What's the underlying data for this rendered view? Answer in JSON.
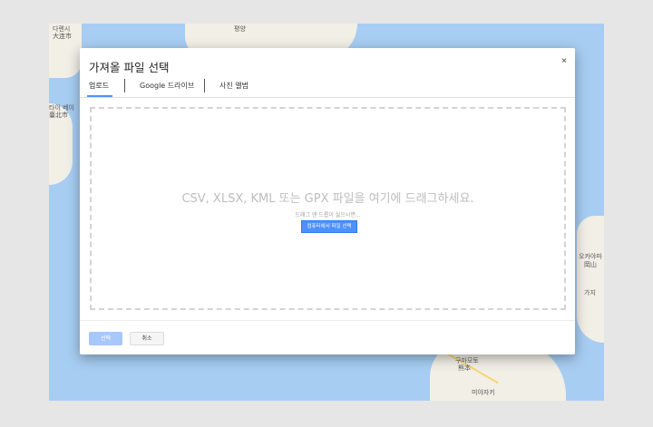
{
  "map": {
    "labels": [
      "다렌시",
      "大连市",
      "평양",
      "타이 베이",
      "臺北市",
      "오카야마",
      "岡山",
      "가지",
      "구마모토",
      "熊本",
      "미야자키"
    ]
  },
  "dialog": {
    "title": "가져올 파일 선택",
    "close_glyph": "×",
    "tabs": [
      {
        "label": "업로드"
      },
      {
        "label": "Google 드라이브"
      },
      {
        "label": "사진 앨범"
      }
    ],
    "dropzone": {
      "heading": "CSV, XLSX, KML 또는 GPX 파일을 여기에 드래그하세요.",
      "subtext": "드래그 앤 드롭이 싫으시면...",
      "choose_button": "컴퓨터에서 파일 선택"
    },
    "footer": {
      "select_button": "선택",
      "cancel_button": "취소"
    }
  },
  "colors": {
    "accent": "#4d90fe",
    "water": "#a7cdf2",
    "land": "#f2efe6"
  }
}
